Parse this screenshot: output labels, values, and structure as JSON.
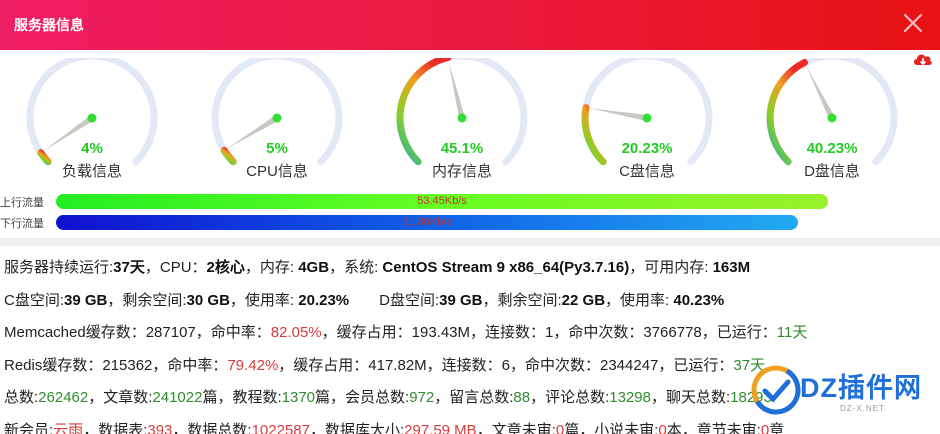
{
  "window": {
    "title": "服务器信息"
  },
  "gauges": [
    {
      "value": "4%",
      "label": "负载信息",
      "percent": 4
    },
    {
      "value": "5%",
      "label": "CPU信息",
      "percent": 5
    },
    {
      "value": "45.1%",
      "label": "内存信息",
      "percent": 45.1
    },
    {
      "value": "20.23%",
      "label": "C盘信息",
      "percent": 20.23
    },
    {
      "value": "40.23%",
      "label": "D盘信息",
      "percent": 40.23
    }
  ],
  "traffic": {
    "up": {
      "label": "上行流量",
      "value": "53.45Kb/s"
    },
    "down": {
      "label": "下行流量",
      "value": "51.36Kb/s"
    }
  },
  "info": {
    "l1": {
      "uptime_label": "服务器持续运行:",
      "uptime": "37天",
      "cpu_label": "，CPU：",
      "cpu": "2核心",
      "mem_label": "，内存: ",
      "mem": "4GB",
      "os_label": "，系统: ",
      "os": "CentOS Stream 9 x86_64(Py3.7.16)",
      "avail_label": "，可用内存: ",
      "avail": "163M"
    },
    "l2": {
      "c_label": "C盘空间:",
      "c_space": "39 GB",
      "c_free_label": "，剩余空间:",
      "c_free": "30 GB",
      "c_usage_label": "，使用率: ",
      "c_usage": "20.23%",
      "d_label": "D盘空间:",
      "d_space": "39 GB",
      "d_free_label": "，剩余空间:",
      "d_free": "22 GB",
      "d_usage_label": "，使用率: ",
      "d_usage": "40.23%"
    },
    "l3": {
      "a": "Memcached缓存数：287107，命中率：",
      "hit": "82.05%",
      "b": "，缓存占用：193.43M，连接数：1，命中次数：3766778，已运行：",
      "run": "11天"
    },
    "l4": {
      "a": "Redis缓存数：215362，命中率：",
      "hit": "79.42%",
      "b": "，缓存占用：417.82M，连接数：6，命中次数：2344247，已运行：",
      "run": "37天"
    },
    "l5": {
      "t1": "总数:",
      "v1": "262462",
      "t2": "，文章数:",
      "v2": "241022",
      "t3": "篇，教程数:",
      "v3": "1370",
      "t4": "篇，会员总数:",
      "v4": "972",
      "t5": "，留言总数:",
      "v5": "88",
      "t6": "，评论总数:",
      "v6": "13298",
      "t7": "，聊天总数:",
      "v7": "18293"
    },
    "l6": {
      "t1": "新会员:",
      "v1": "云雨",
      "t2": "，数据表:",
      "v2": "393",
      "t3": "，数据总数:",
      "v3": "1022587",
      "t4": "，数据库大小:",
      "v4": "297.59 MB",
      "t5": "，文章未审:",
      "v5": "0",
      "t6": "篇，小说未审:",
      "v6": "0",
      "t7": "本，章节未审:",
      "v7": "0",
      "t8": "章"
    }
  },
  "watermark": {
    "text": "DZ插件网",
    "sub": "DZ-X.NET"
  },
  "colors": {
    "title_start": "#ee1e63",
    "title_end": "#e81212",
    "value_green": "#22cc22",
    "stat_green": "#2e8b2e",
    "stat_red": "#d93a3a"
  }
}
